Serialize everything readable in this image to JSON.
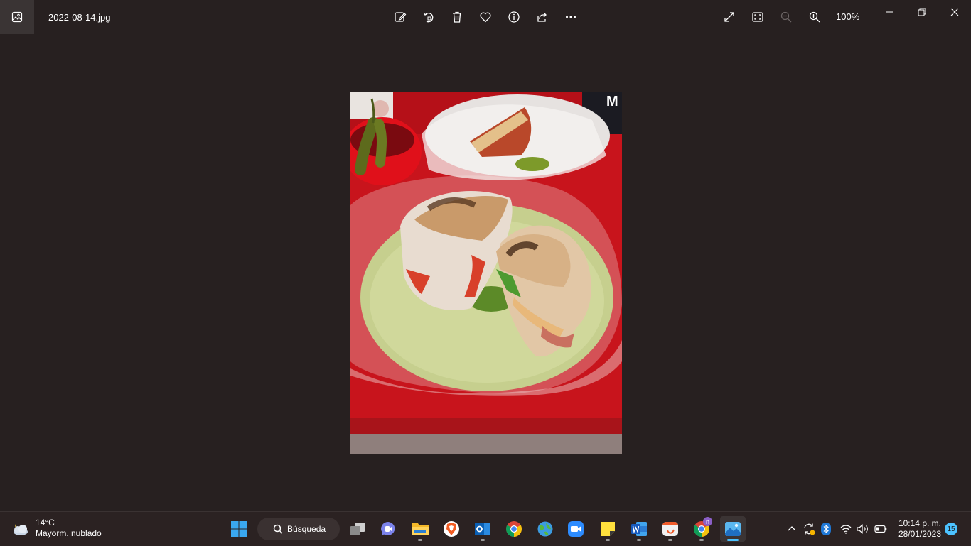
{
  "titlebar": {
    "filename": "2022-08-14.jpg",
    "zoom": "100%",
    "tools": [
      "edit-icon",
      "rotate-icon",
      "delete-icon",
      "favorite-icon",
      "info-icon",
      "share-icon",
      "more-icon"
    ],
    "view": [
      "fullscreen-icon",
      "fit-window-icon",
      "zoom-out-icon",
      "zoom-in-icon"
    ]
  },
  "taskbar": {
    "weather": {
      "temp": "14°C",
      "condition": "Mayorm. nublado"
    },
    "search_label": "Búsqueda",
    "apps": [
      "task-view",
      "teams",
      "file-explorer",
      "brave",
      "outlook",
      "chrome",
      "maps",
      "zoom",
      "sticky-notes",
      "word",
      "app",
      "chrome-profile",
      "photos"
    ],
    "chrome_badge": "n",
    "clock": {
      "time": "10:14 p. m.",
      "date": "28/01/2023"
    },
    "notifications": "15"
  },
  "colors": {
    "background": "#272020",
    "accent": "#4cc2ff"
  }
}
